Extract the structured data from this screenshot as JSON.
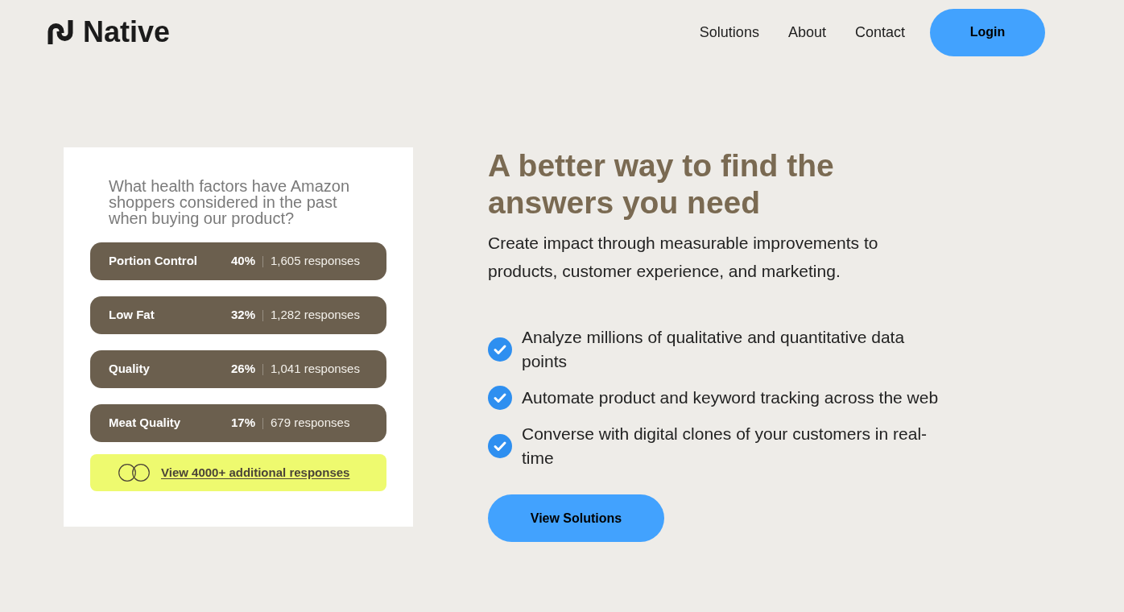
{
  "logo": {
    "text": "Native"
  },
  "nav": {
    "links": [
      "Solutions",
      "About",
      "Contact"
    ],
    "login": "Login"
  },
  "survey_card": {
    "question": "What health factors have Amazon shoppers considered in the past when buying our product?",
    "results": [
      {
        "label": "Portion Control",
        "percent": "40%",
        "responses": "1,605 responses"
      },
      {
        "label": "Low Fat",
        "percent": "32%",
        "responses": "1,282 responses"
      },
      {
        "label": "Quality",
        "percent": "26%",
        "responses": "1,041 responses"
      },
      {
        "label": "Meat Quality",
        "percent": "17%",
        "responses": "679 responses"
      }
    ],
    "more_link": "View 4000+ additional responses"
  },
  "hero": {
    "headline": "A better way to find the answers you need",
    "subtext": "Create impact through measurable improvements to products, customer experience, and marketing.",
    "features": [
      "Analyze millions of qualitative and quantitative data points",
      "Automate product and keyword tracking across the web",
      "Converse with digital clones of your customers in real-time"
    ],
    "cta": "View Solutions"
  }
}
